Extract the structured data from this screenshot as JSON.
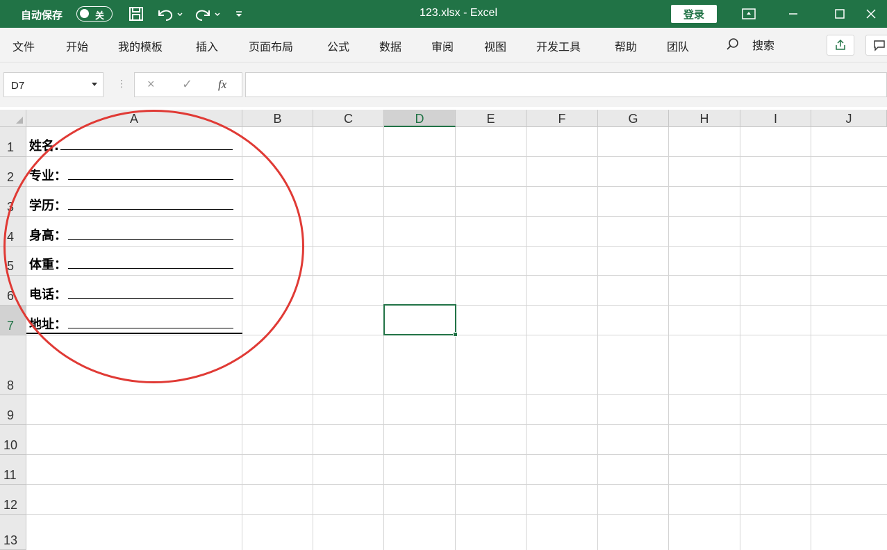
{
  "titlebar": {
    "autosave_label": "自动保存",
    "autosave_state": "关",
    "doc_title": "123.xlsx  -  Excel",
    "login_label": "登录",
    "accent_color": "#217346"
  },
  "ribbon": {
    "tabs": [
      "文件",
      "开始",
      "我的模板",
      "插入",
      "页面布局",
      "公式",
      "数据",
      "审阅",
      "视图",
      "开发工具",
      "帮助",
      "团队"
    ],
    "search_label": "搜索"
  },
  "formula_bar": {
    "name_box": "D7",
    "cancel": "×",
    "confirm": "✓",
    "fx": "fx",
    "formula": ""
  },
  "sheet": {
    "columns": [
      "A",
      "B",
      "C",
      "D",
      "E",
      "F",
      "G",
      "H",
      "I",
      "J"
    ],
    "rows": [
      "1",
      "2",
      "3",
      "4",
      "5",
      "6",
      "7",
      "8",
      "9",
      "10",
      "11",
      "12",
      "13"
    ],
    "selected_column": "D",
    "selected_row": "7",
    "cells_A": [
      "姓名.",
      "专业：",
      "学历：",
      "身高：",
      "体重：",
      "电话：",
      "地址："
    ],
    "annotation_color": "#e03a35"
  }
}
